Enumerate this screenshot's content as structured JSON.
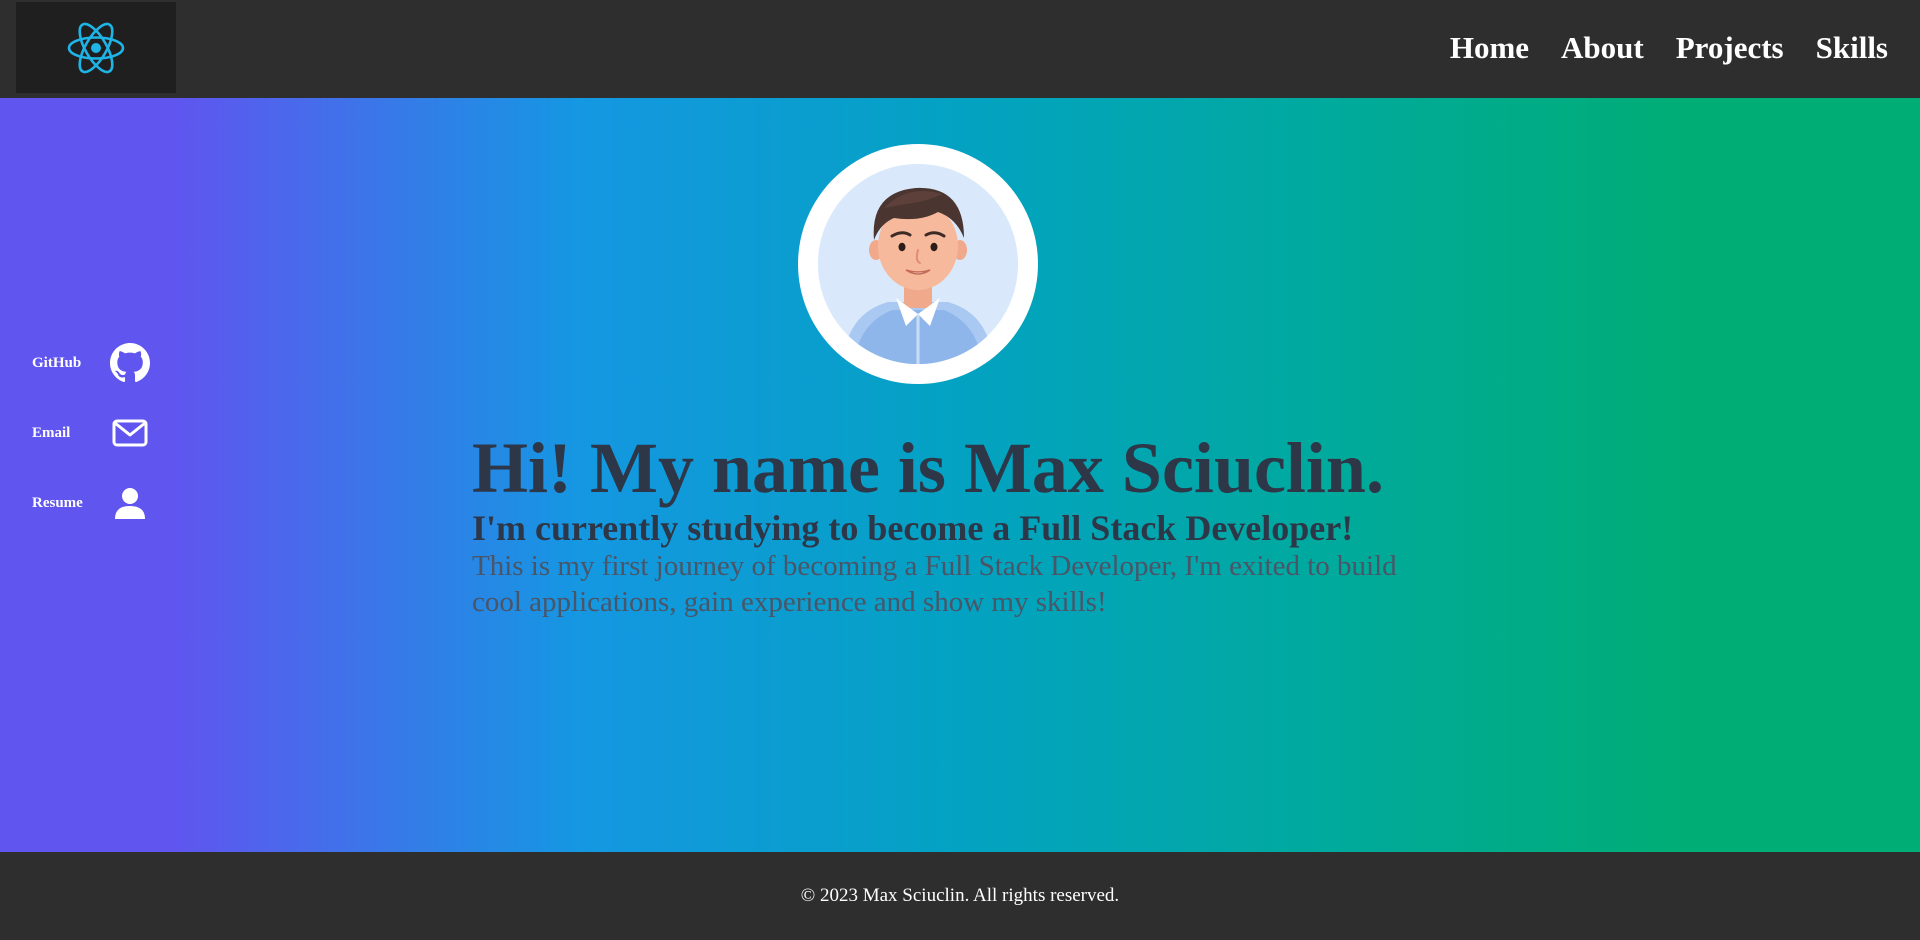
{
  "navbar": {
    "logo_icon": "react-atom-icon",
    "links": [
      {
        "label": "Home"
      },
      {
        "label": "About"
      },
      {
        "label": "Projects"
      },
      {
        "label": "Skills"
      }
    ]
  },
  "sidebar": {
    "links": [
      {
        "label": "GitHub",
        "icon": "github-icon"
      },
      {
        "label": "Email",
        "icon": "mail-icon"
      },
      {
        "label": "Resume",
        "icon": "user-icon"
      }
    ]
  },
  "hero": {
    "avatar": "profile-avatar",
    "title": "Hi! My name is Max Sciuclin.",
    "subtitle": "I'm currently studying to become a Full Stack Developer!",
    "description": "This is my first journey of becoming a Full Stack Developer, I'm exited to build cool applications, gain experience and show my skills!"
  },
  "footer": {
    "copyright": "© 2023 Max Sciuclin. All rights reserved."
  },
  "colors": {
    "nav_background": "#2e2e2e",
    "logo_background": "#1f1f1f",
    "react_cyan": "#1fb4e6",
    "gradient_start": "#6055ef",
    "gradient_mid": "#1597e2",
    "gradient_end": "#00ad74",
    "heading_text": "#2d3748",
    "body_text": "#4a5568"
  }
}
